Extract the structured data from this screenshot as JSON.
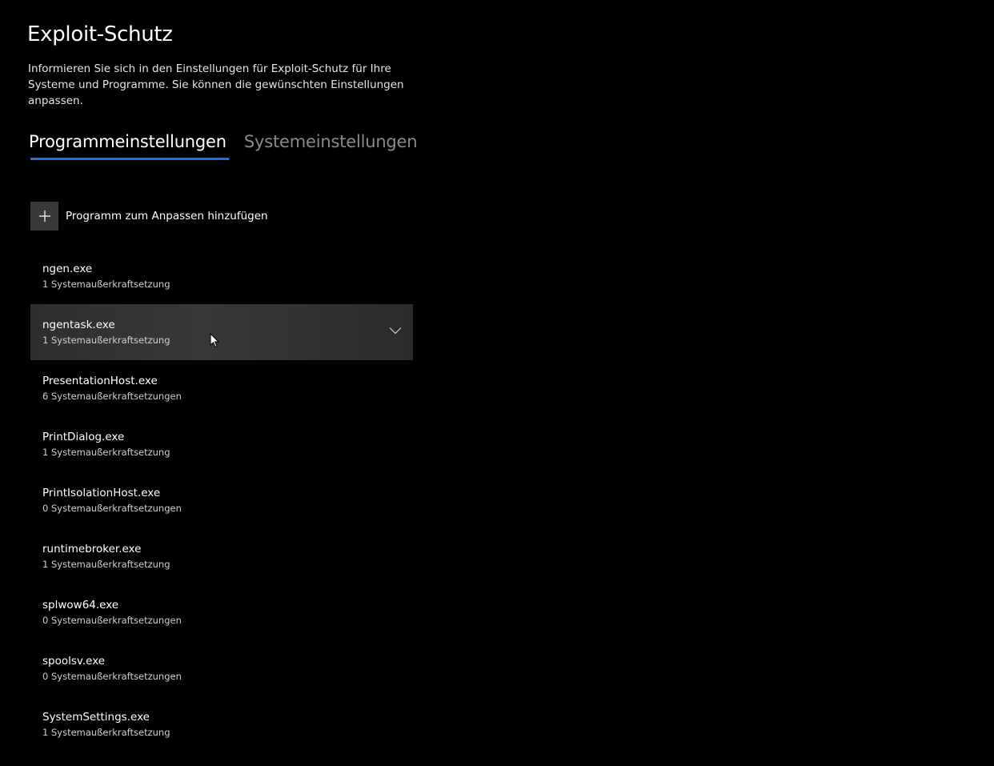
{
  "page": {
    "title": "Exploit-Schutz",
    "description": "Informieren Sie sich in den Einstellungen für Exploit-Schutz für Ihre Systeme und Programme. Sie können die gewünschten Einstellungen anpassen."
  },
  "tabs": [
    {
      "label": "Programmeinstellungen",
      "active": true
    },
    {
      "label": "Systemeinstellungen",
      "active": false
    }
  ],
  "add_program": {
    "label": "Programm zum Anpassen hinzufügen",
    "icon": "plus-icon"
  },
  "programs": [
    {
      "name": "ngen.exe",
      "overrides": "1 Systemaußerkraftsetzung"
    },
    {
      "name": "ngentask.exe",
      "overrides": "1 Systemaußerkraftsetzung",
      "hovered": true
    },
    {
      "name": "PresentationHost.exe",
      "overrides": "6 Systemaußerkraftsetzungen"
    },
    {
      "name": "PrintDialog.exe",
      "overrides": "1 Systemaußerkraftsetzung"
    },
    {
      "name": "PrintIsolationHost.exe",
      "overrides": "0 Systemaußerkraftsetzungen"
    },
    {
      "name": "runtimebroker.exe",
      "overrides": "1 Systemaußerkraftsetzung"
    },
    {
      "name": "splwow64.exe",
      "overrides": "0 Systemaußerkraftsetzungen"
    },
    {
      "name": "spoolsv.exe",
      "overrides": "0 Systemaußerkraftsetzungen"
    },
    {
      "name": "SystemSettings.exe",
      "overrides": "1 Systemaußerkraftsetzung"
    }
  ],
  "colors": {
    "background": "#000000",
    "accent": "#1a73d6",
    "inactive_tab": "#8a8a8a",
    "hover_row": "#333333",
    "add_button": "#3a3a3a"
  }
}
